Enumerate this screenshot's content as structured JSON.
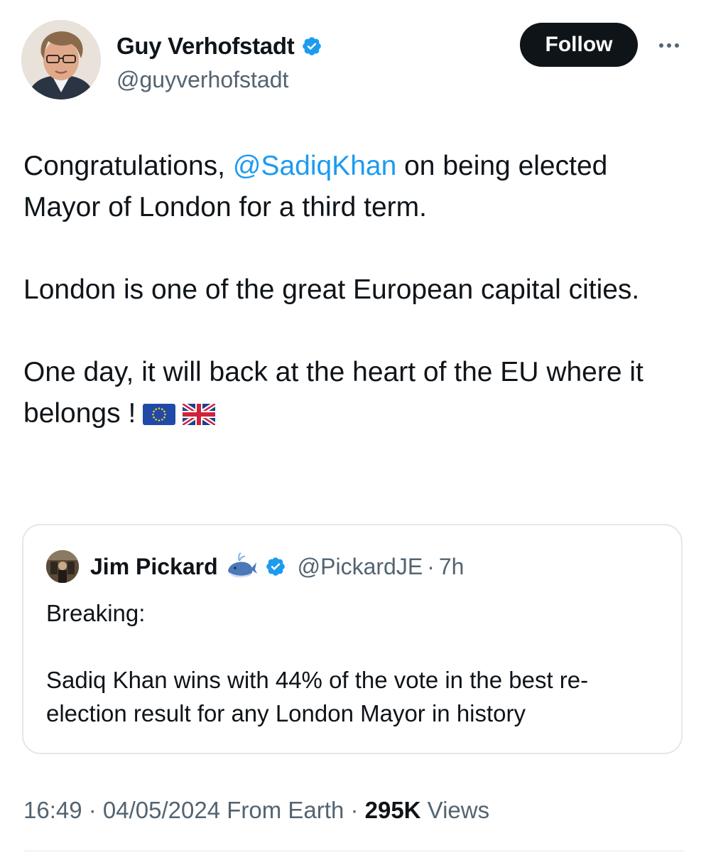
{
  "author": {
    "name": "Guy Verhofstadt",
    "handle": "@guyverhofstadt",
    "verified": true,
    "avatar_icon": "profile-photo"
  },
  "actions": {
    "follow_label": "Follow",
    "more_icon": "more-horizontal-icon"
  },
  "tweet": {
    "p1_before": "Congratulations, ",
    "p1_mention": "@SadiqKhan",
    "p1_after": " on being elected Mayor of London for a third term.",
    "p2": "London is one of the great European capital cities.",
    "p3": "One day, it will back at the heart of the EU where it belongs !",
    "emojis": [
      "eu-flag-icon",
      "uk-flag-icon"
    ]
  },
  "quote": {
    "name": "Jim Pickard",
    "handle": "@PickardJE",
    "separator": "·",
    "time": "7h",
    "badge_icon": "whale-emoji-icon",
    "verified": true,
    "line1": "Breaking:",
    "line2": "Sadiq Khan wins with 44% of the vote in the best re-election result for any London Mayor in history"
  },
  "meta": {
    "time": "16:49",
    "sep1": " · ",
    "date": "04/05/2024",
    "source": " From Earth",
    "sep2": " · ",
    "views_count": "295K",
    "views_label": " Views"
  },
  "colors": {
    "text": "#0f1419",
    "secondary": "#536471",
    "link": "#1d9bf0",
    "verified": "#1d9bf0",
    "follow_bg": "#0f1419",
    "border": "#e1e8ed"
  }
}
